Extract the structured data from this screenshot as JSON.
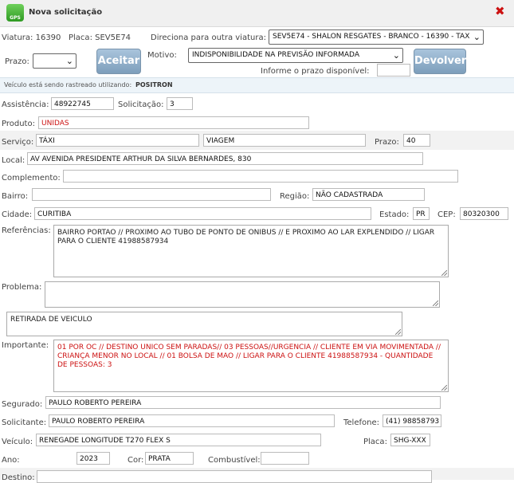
{
  "window": {
    "title": "Nova solicitação",
    "logo_text": "GPS"
  },
  "viatura": {
    "label": "Viatura:",
    "value": "16390",
    "placa_label": "Placa:",
    "placa_value": "SEV5E74",
    "direciona_label": "Direciona para outra viatura:",
    "direciona_value": "SEV5E74 - SHALON RESGATES - BRANCO - 16390 - TAX"
  },
  "prazo": {
    "label": "Prazo:",
    "value": ""
  },
  "buttons": {
    "aceitar": "Aceitar",
    "devolver": "Devolver"
  },
  "motivo": {
    "label": "Motivo:",
    "value": "INDISPONIBILIDADE NA PREVISÃO INFORMADA"
  },
  "prazo_disponivel": {
    "label": "Informe o prazo disponível:",
    "value": ""
  },
  "rastreio": {
    "text": "Veículo está sendo rastreado utilizando:",
    "value": "POSITRON"
  },
  "form": {
    "assistencia": {
      "label": "Assistência:",
      "value": "48922745"
    },
    "solicitacao": {
      "label": "Solicitação:",
      "value": "3"
    },
    "produto": {
      "label": "Produto:",
      "value": "UNIDAS"
    },
    "servico": {
      "label": "Serviço:",
      "value": "TÁXI",
      "value2": "VIAGEM"
    },
    "prazo": {
      "label": "Prazo:",
      "value": "40"
    },
    "local": {
      "label": "Local:",
      "value": "AV AVENIDA PRESIDENTE ARTHUR DA SILVA BERNARDES, 830"
    },
    "complemento": {
      "label": "Complemento:",
      "value": ""
    },
    "bairro": {
      "label": "Bairro:",
      "value": ""
    },
    "regiao": {
      "label": "Região:",
      "value": "NÃO CADASTRADA"
    },
    "cidade": {
      "label": "Cidade:",
      "value": "CURITIBA"
    },
    "estado": {
      "label": "Estado:",
      "value": "PR"
    },
    "cep": {
      "label": "CEP:",
      "value": "80320300"
    },
    "referencias": {
      "label": "Referências:",
      "value": "BAIRRO PORTAO //  PROXIMO AO TUBO DE PONTO DE ONIBUS // E PROXIMO AO LAR EXPLENDIDO //  LIGAR PARA O CLIENTE 41988587934"
    },
    "problema": {
      "label": "Problema:",
      "value": ""
    },
    "retirada": {
      "value": "RETIRADA DE VEICULO"
    },
    "importante": {
      "label": "Importante:",
      "value": "01 POR OC // DESTINO UNICO SEM PARADAS// 03 PESSOAS//URGENCIA // CLIENTE EM VIA MOVIMENTADA // CRIANÇA MENOR NO LOCAL // 01 BOLSA DE MAO  // LIGAR PARA O CLIENTE  41988587934 - QUANTIDADE DE PESSOAS:  3"
    },
    "segurado": {
      "label": "Segurado:",
      "value": "PAULO ROBERTO PEREIRA"
    },
    "solicitante": {
      "label": "Solicitante:",
      "value": "PAULO ROBERTO PEREIRA"
    },
    "telefone": {
      "label": "Telefone:",
      "value": "(41) 98858793"
    },
    "veiculo": {
      "label": "Veículo:",
      "value": "RENEGADE LONGITUDE T270 FLEX S"
    },
    "placa": {
      "label": "Placa:",
      "value": "SHG-XXX"
    },
    "ano": {
      "label": "Ano:",
      "value": "2023"
    },
    "cor": {
      "label": "Cor:",
      "value": "PRATA"
    },
    "combustivel": {
      "label": "Combustível:",
      "value": ""
    },
    "destino": {
      "label": "Destino:",
      "value": ""
    }
  },
  "colors": {
    "accent_red": "#cc1111",
    "button": "#8fb0cc",
    "info_bg": "#edf4f9"
  }
}
